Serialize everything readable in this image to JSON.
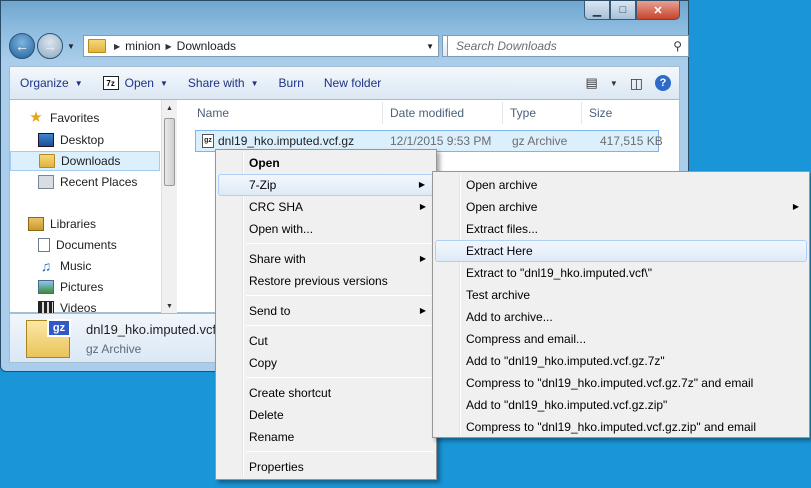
{
  "window": {
    "caption": {
      "minimize": "▁",
      "maximize": "□",
      "close": "✕"
    },
    "breadcrumb": [
      "minion",
      "Downloads"
    ],
    "search_placeholder": "Search Downloads"
  },
  "toolbar": {
    "organize": "Organize",
    "open": "Open",
    "open_icon_text": "7z",
    "share_with": "Share with",
    "burn": "Burn",
    "new_folder": "New folder",
    "help": "?"
  },
  "nav": {
    "favorites": "Favorites",
    "desktop": "Desktop",
    "downloads": "Downloads",
    "recent_places": "Recent Places",
    "libraries": "Libraries",
    "documents": "Documents",
    "music": "Music",
    "pictures": "Pictures",
    "videos": "Videos"
  },
  "columns": {
    "name": "Name",
    "date_modified": "Date modified",
    "type": "Type",
    "size": "Size"
  },
  "file": {
    "icon_text": "gz",
    "name": "dnl19_hko.imputed.vcf.gz",
    "date": "12/1/2015 9:53 PM",
    "type": "gz Archive",
    "size": "417,515 KB"
  },
  "details": {
    "icon_text": "gz",
    "name": "dnl19_hko.imputed.vcf.",
    "type": "gz Archive"
  },
  "context_menu": {
    "open": "Open",
    "seven_zip": "7-Zip",
    "crc_sha": "CRC SHA",
    "open_with": "Open with...",
    "share_with": "Share with",
    "restore_versions": "Restore previous versions",
    "send_to": "Send to",
    "cut": "Cut",
    "copy": "Copy",
    "create_shortcut": "Create shortcut",
    "delete": "Delete",
    "rename": "Rename",
    "properties": "Properties"
  },
  "seven_zip_menu": {
    "open_archive": "Open archive",
    "open_archive_sub": "Open archive",
    "extract_files": "Extract files...",
    "extract_here": "Extract Here",
    "extract_to": "Extract to \"dnl19_hko.imputed.vcf\\\"",
    "test_archive": "Test archive",
    "add_to_archive": "Add to archive...",
    "compress_email": "Compress and email...",
    "add_to_7z": "Add to \"dnl19_hko.imputed.vcf.gz.7z\"",
    "compress_7z_email": "Compress to \"dnl19_hko.imputed.vcf.gz.7z\" and email",
    "add_to_zip": "Add to \"dnl19_hko.imputed.vcf.gz.zip\"",
    "compress_zip_email": "Compress to \"dnl19_hko.imputed.vcf.gz.zip\" and email"
  }
}
